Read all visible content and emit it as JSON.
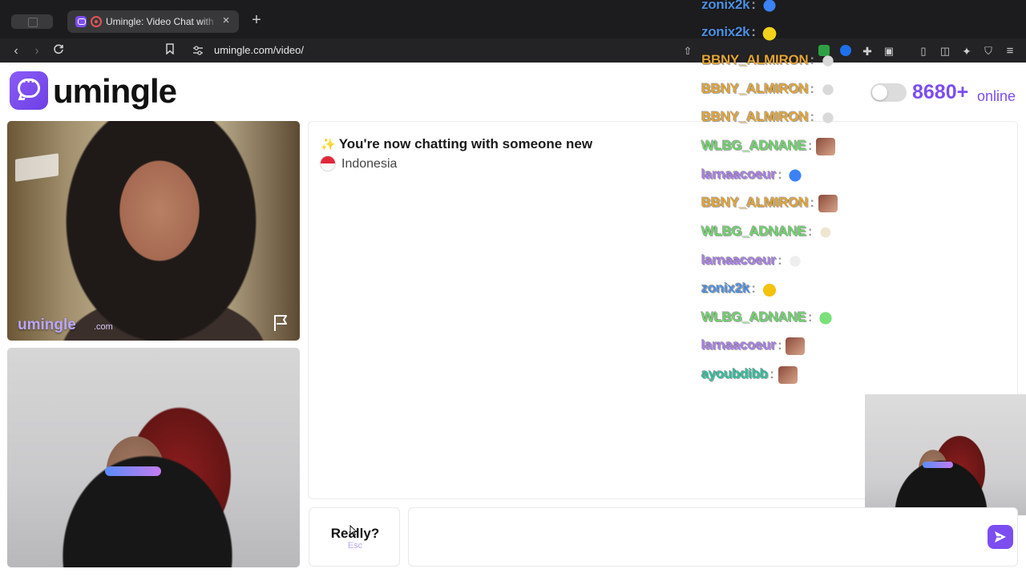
{
  "browser": {
    "tab_title": "Umingle: Video Chat with Strangers",
    "url": "umingle.com/video/"
  },
  "site": {
    "logo_text": "umingle",
    "online_count": "8680+",
    "online_label": "online",
    "online_toggle_on": false,
    "accent_color": "#7c4df0"
  },
  "video": {
    "brand_text": "umingle",
    "brand_suffix": ".com"
  },
  "chat": {
    "system_message": "You're now chatting with someone new",
    "country": "Indonesia"
  },
  "composer": {
    "esc_label": "Really?",
    "esc_hint": "Esc"
  },
  "stream_chat": [
    {
      "user": "zonix2k",
      "color": "#4d8fe0",
      "emote": "blue-fish-emote"
    },
    {
      "user": "zonix2k",
      "color": "#4d8fe0",
      "emote": "yellow-blob-emote"
    },
    {
      "user": "BBNY_ALMIRON",
      "color": "#e3a435",
      "emote": "hands-emote"
    },
    {
      "user": "BBNY_ALMIRON",
      "color": "#e3a435",
      "emote": "hands-emote"
    },
    {
      "user": "BBNY_ALMIRON",
      "color": "#e3a435",
      "emote": "hands-emote"
    },
    {
      "user": "WLBG_ADNANE",
      "color": "#6ed36b",
      "emote": "face-photo-emote"
    },
    {
      "user": "larnaacoeur",
      "color": "#a77de8",
      "emote": "blue-fish-emote"
    },
    {
      "user": "BBNY_ALMIRON",
      "color": "#e3a435",
      "emote": "face-photo-emote"
    },
    {
      "user": "WLBG_ADNANE",
      "color": "#6ed36b",
      "emote": "cat-emote"
    },
    {
      "user": "larnaacoeur",
      "color": "#a77de8",
      "emote": "sunglasses-face-emote"
    },
    {
      "user": "zonix2k",
      "color": "#4d8fe0",
      "emote": "bee-emote"
    },
    {
      "user": "WLBG_ADNANE",
      "color": "#6ed36b",
      "emote": "green-blob-emote"
    },
    {
      "user": "larnaacoeur",
      "color": "#a77de8",
      "emote": "face-photo-emote"
    },
    {
      "user": "ayoubdibb",
      "color": "#2bbf9e",
      "emote": "face-photo-emote"
    }
  ]
}
